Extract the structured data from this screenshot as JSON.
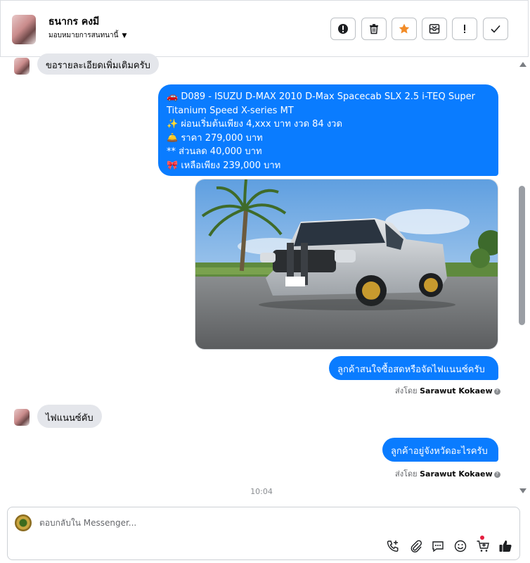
{
  "header": {
    "contact_name": "ธนากร คงมี",
    "assign_label": "มอบหมายการสนทนานี้",
    "buttons": [
      "spam-icon",
      "trash-icon",
      "star-icon",
      "mark-unread-icon",
      "follow-up-icon",
      "done-icon"
    ]
  },
  "messages": {
    "m1_text": "ขอรายละเอียดเพิ่มเติมครับ",
    "m2_lines": [
      "🚗 D089 - ISUZU D-MAX 2010 D-Max Spacecab SLX 2.5 i-TEQ Super",
      "Titanium Speed X-series MT",
      "✨ ผ่อนเริ่มต้นเพียง 4,xxx บาท งวด 84 งวด",
      "🛎️  ราคา 279,000 บาท",
      "** ส่วนลด 40,000 บาท",
      "🎀 เหลือเพียง 239,000 บาท"
    ],
    "m3_text": "ลูกค้าสนใจซื้อสดหรือจัดไฟแนนซ์ครับ",
    "sent_by_prefix": "ส่งโดย",
    "sent_by_name": "Sarawut Kokaew",
    "m4_text": "ไฟแนนซ์คับ",
    "m5_text": "ลูกค้าอยู่จังหวัดอะไรครับ",
    "timestamp": "10:04"
  },
  "composer": {
    "placeholder": "ตอบกลับใน Messenger...",
    "tools": [
      "call-icon",
      "attach-icon",
      "saved-reply-icon",
      "emoji-icon",
      "cart-icon",
      "like-icon"
    ]
  },
  "colors": {
    "outgoing_bubble": "#0a7cff",
    "incoming_bubble": "#e4e6eb",
    "star": "#f28c28"
  }
}
